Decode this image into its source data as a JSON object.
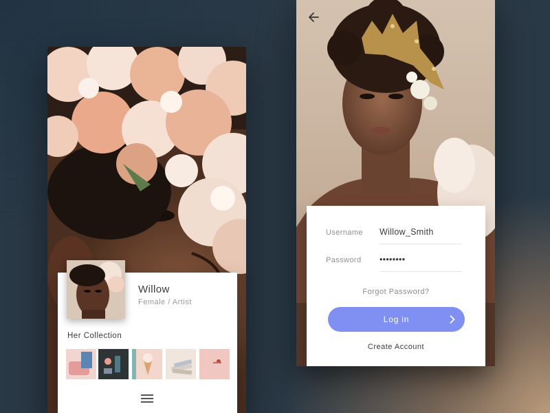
{
  "profile_screen": {
    "name": "Willow",
    "role": "Female / Artist",
    "collection_title": "Her Collection",
    "collection_thumbs": [
      {
        "icon": "pink-sofa-photo",
        "color": "#e9b8b0"
      },
      {
        "icon": "dark-objects-photo",
        "color": "#2e3436"
      },
      {
        "icon": "ice-cream-cone-photo",
        "color": "#f3d6cc"
      },
      {
        "icon": "book-stack-photo",
        "color": "#eee3da"
      },
      {
        "icon": "pink-wall-photo",
        "color": "#f0c7c1"
      }
    ]
  },
  "login_screen": {
    "username_label": "Username",
    "username_value": "Willow_Smith",
    "password_label": "Password",
    "password_value": "••••••••",
    "forgot_label": "Forgot Password?",
    "login_label": "Log in",
    "create_account_label": "Create Account"
  },
  "colors": {
    "accent": "#7f8ff2",
    "card": "#ffffff",
    "background": "#2a3946"
  }
}
